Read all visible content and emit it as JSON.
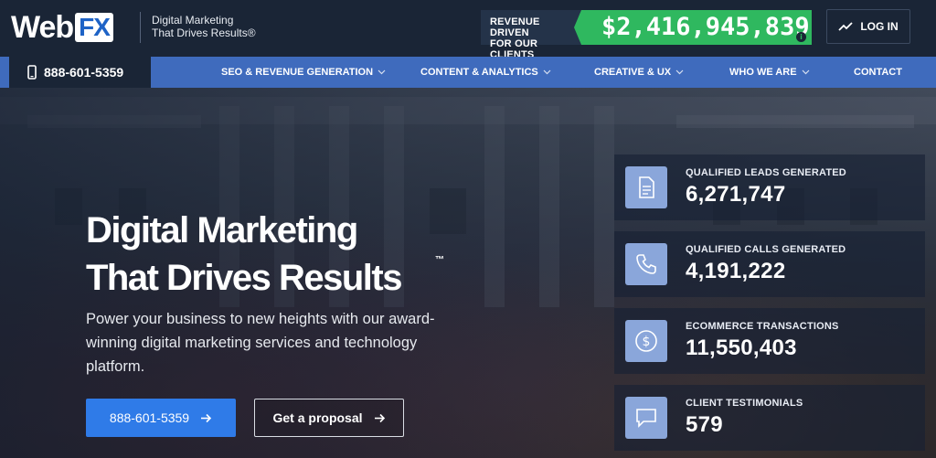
{
  "header": {
    "logo_web": "Web",
    "logo_fx": "FX",
    "tagline_line1": "Digital Marketing",
    "tagline_line2": "That Drives Results®",
    "revenue_label_line1": "REVENUE DRIVEN",
    "revenue_label_line2": "FOR OUR CLIENTS",
    "revenue_value": "$2,416,945,839",
    "info_icon": "i",
    "login_label": "LOG IN"
  },
  "nav": {
    "phone": "888-601-5359",
    "items": [
      {
        "label": "SEO & REVENUE GENERATION",
        "dropdown": true
      },
      {
        "label": "CONTENT & ANALYTICS",
        "dropdown": true
      },
      {
        "label": "CREATIVE & UX",
        "dropdown": true
      },
      {
        "label": "WHO WE ARE",
        "dropdown": true
      },
      {
        "label": "CONTACT",
        "dropdown": false
      }
    ]
  },
  "hero": {
    "title_line1": "Digital Marketing",
    "title_line2": "That Drives Results",
    "trademark": "™",
    "subtitle": "Power your business to new heights with our award-winning digital marketing services and technology platform.",
    "phone_button": "888-601-5359",
    "proposal_button": "Get a proposal"
  },
  "stats": [
    {
      "label": "QUALIFIED LEADS GENERATED",
      "value": "6,271,747",
      "icon": "document-icon"
    },
    {
      "label": "QUALIFIED CALLS GENERATED",
      "value": "4,191,222",
      "icon": "phone-icon"
    },
    {
      "label": "ECOMMERCE TRANSACTIONS",
      "value": "11,550,403",
      "icon": "dollar-icon"
    },
    {
      "label": "CLIENT TESTIMONIALS",
      "value": "579",
      "icon": "chat-icon"
    }
  ],
  "colors": {
    "header_bg": "#1a2536",
    "nav_bg": "#3f6bbd",
    "revenue_green": "#2fb85f",
    "button_blue": "#2f7be8",
    "stat_icon_bg": "#8aa6da"
  }
}
